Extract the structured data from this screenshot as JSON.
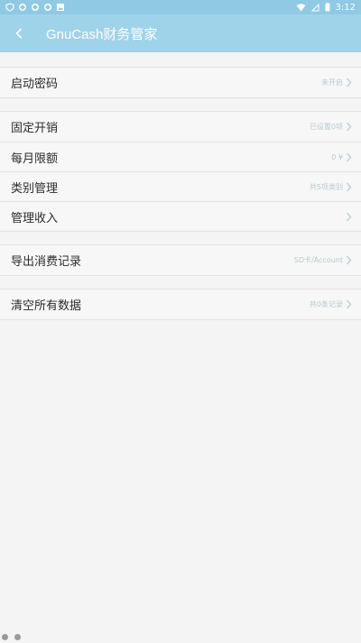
{
  "status_bar": {
    "time": "3:12"
  },
  "toolbar": {
    "title": "GnuCash财务管家"
  },
  "groups": [
    {
      "rows": [
        {
          "label": "启动密码",
          "value": "未开启"
        }
      ]
    },
    {
      "rows": [
        {
          "label": "固定开销",
          "value": "已设置0项"
        },
        {
          "label": "每月限额",
          "value": "0 ¥"
        },
        {
          "label": "类别管理",
          "value": "共5项类别"
        },
        {
          "label": "管理收入",
          "value": ""
        }
      ]
    },
    {
      "rows": [
        {
          "label": "导出消费记录",
          "value": "SD卡/Account"
        }
      ]
    },
    {
      "rows": [
        {
          "label": "清空所有数据",
          "value": "共0条记录"
        }
      ]
    }
  ],
  "colors": {
    "toolbar": "#9fd3ea",
    "status_bar": "#8fc9e3",
    "background": "#f4f4f4"
  }
}
